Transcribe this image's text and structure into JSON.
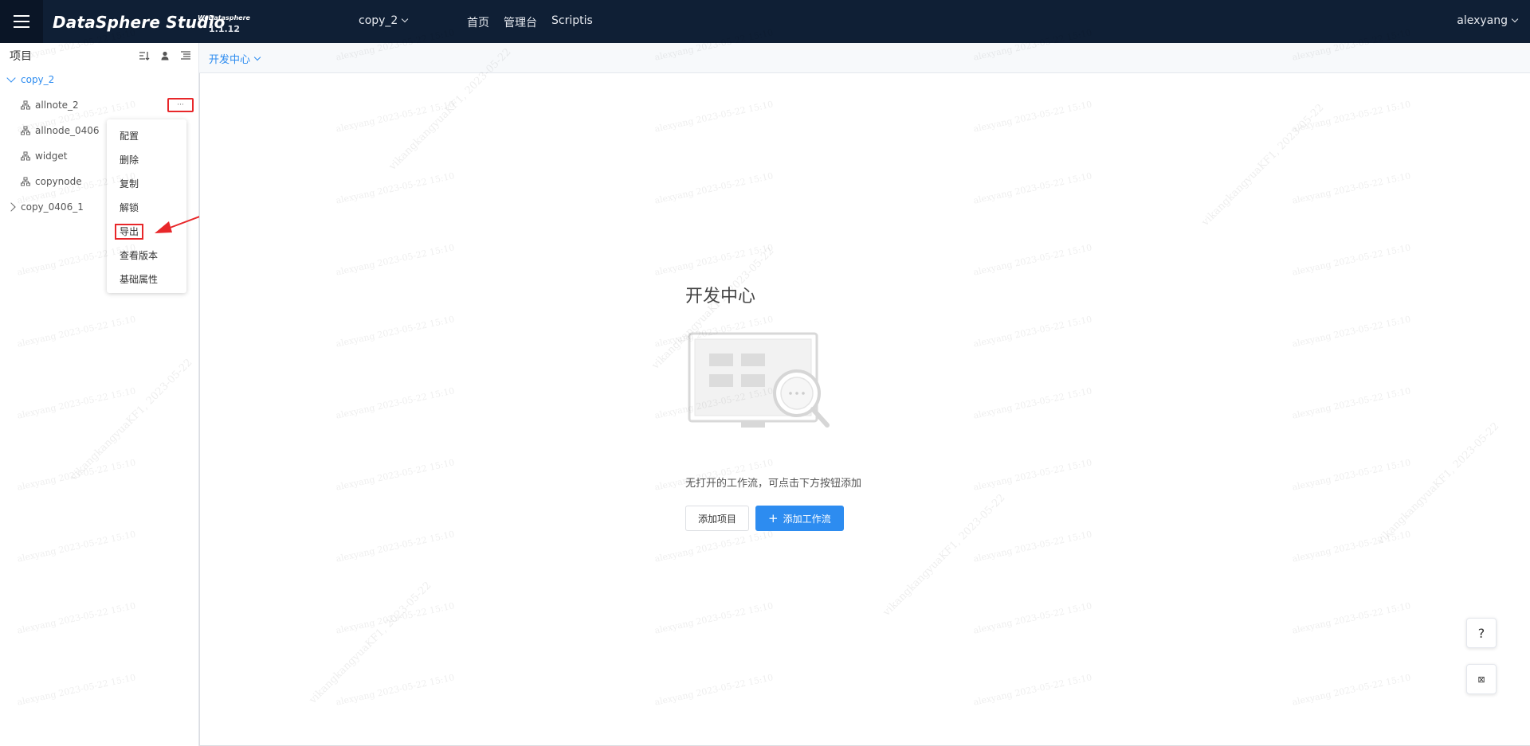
{
  "header": {
    "logo": "DataSphere Studio",
    "logo_sub": "WeDatasphere",
    "version": "1.1.12",
    "project_switch": "copy_2",
    "nav": [
      "首页",
      "管理台",
      "Scriptis"
    ],
    "user": "alexyang"
  },
  "sidebar": {
    "title": "项目",
    "tree": [
      {
        "label": "copy_2",
        "expanded": true
      },
      {
        "label": "allnote_2"
      },
      {
        "label": "allnode_0406"
      },
      {
        "label": "widget"
      },
      {
        "label": "copynode"
      },
      {
        "label": "copy_0406_1",
        "expanded": false
      }
    ],
    "more_label": "···",
    "context_menu": [
      "配置",
      "删除",
      "复制",
      "解锁",
      "导出",
      "查看版本",
      "基础属性"
    ]
  },
  "main": {
    "tab_label": "开发中心",
    "empty_title": "开发中心",
    "empty_text": "无打开的工作流，可点击下方按钮添加",
    "btn_add_project": "添加项目",
    "btn_add_workflow": "添加工作流",
    "help": "?",
    "fab2": "⊠"
  },
  "watermark": {
    "text": "alexyang 2023-05-22 15:10",
    "text2": "vikangkangyuaKF1, 2023-05-22"
  },
  "colors": {
    "header_bg": "#0f1f35",
    "accent": "#2d8cf0",
    "annotation": "#e8272a"
  }
}
